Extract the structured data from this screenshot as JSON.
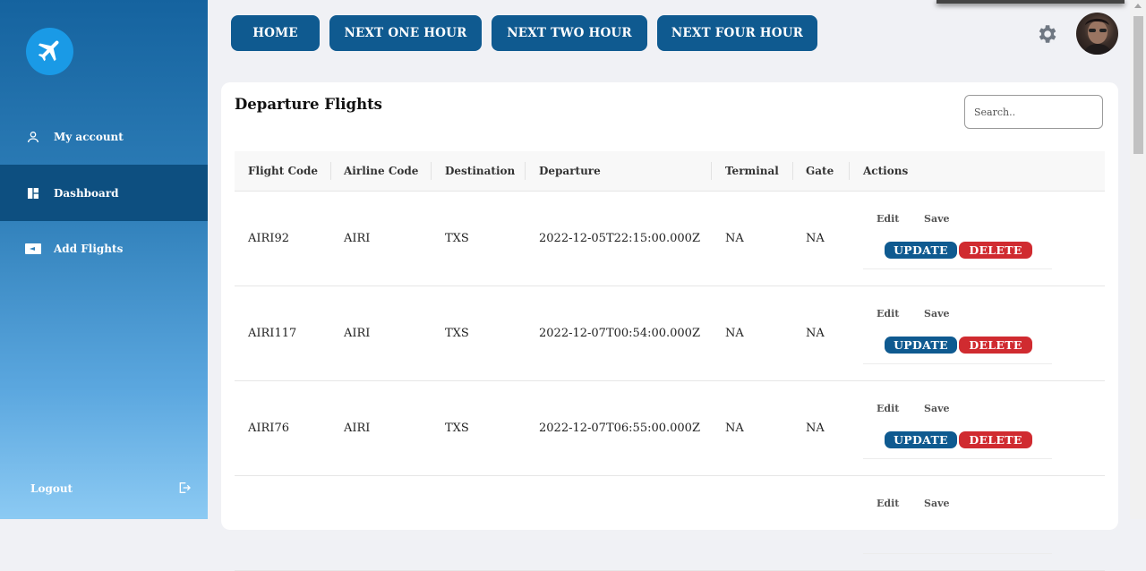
{
  "sidebar": {
    "logo_icon": "airplane-icon",
    "items": [
      {
        "label": "My account",
        "icon": "user-icon"
      },
      {
        "label": "Dashboard",
        "icon": "dashboard-icon"
      },
      {
        "label": "Add Flights",
        "icon": "ticket-icon"
      }
    ],
    "logout_label": "Logout"
  },
  "topbar": {
    "buttons": [
      "HOME",
      "NEXT ONE HOUR",
      "NEXT TWO HOUR",
      "NEXT FOUR HOUR"
    ],
    "settings_icon": "gear-icon",
    "avatar": "user-avatar"
  },
  "main": {
    "title": "Departure Flights",
    "search_placeholder": "Search..",
    "columns": [
      "Flight Code",
      "Airline Code",
      "Destination",
      "Departure",
      "Terminal",
      "Gate",
      "Actions"
    ],
    "rows": [
      {
        "flight_code": "AIRI92",
        "airline_code": "AIRI",
        "destination": "TXS",
        "departure": "2022-12-05T22:15:00.000Z",
        "terminal": "NA",
        "gate": "NA"
      },
      {
        "flight_code": "AIRI117",
        "airline_code": "AIRI",
        "destination": "TXS",
        "departure": "2022-12-07T00:54:00.000Z",
        "terminal": "NA",
        "gate": "NA"
      },
      {
        "flight_code": "AIRI76",
        "airline_code": "AIRI",
        "destination": "TXS",
        "departure": "2022-12-07T06:55:00.000Z",
        "terminal": "NA",
        "gate": "NA"
      }
    ],
    "actions": {
      "edit": "Edit",
      "save": "Save",
      "update": "UPDATE",
      "delete": "DELETE"
    }
  },
  "colors": {
    "primary": "#0f5a90",
    "danger": "#d02b30",
    "sidebar_active": "#0d4f80",
    "logo_bg": "#1a9ae6"
  }
}
